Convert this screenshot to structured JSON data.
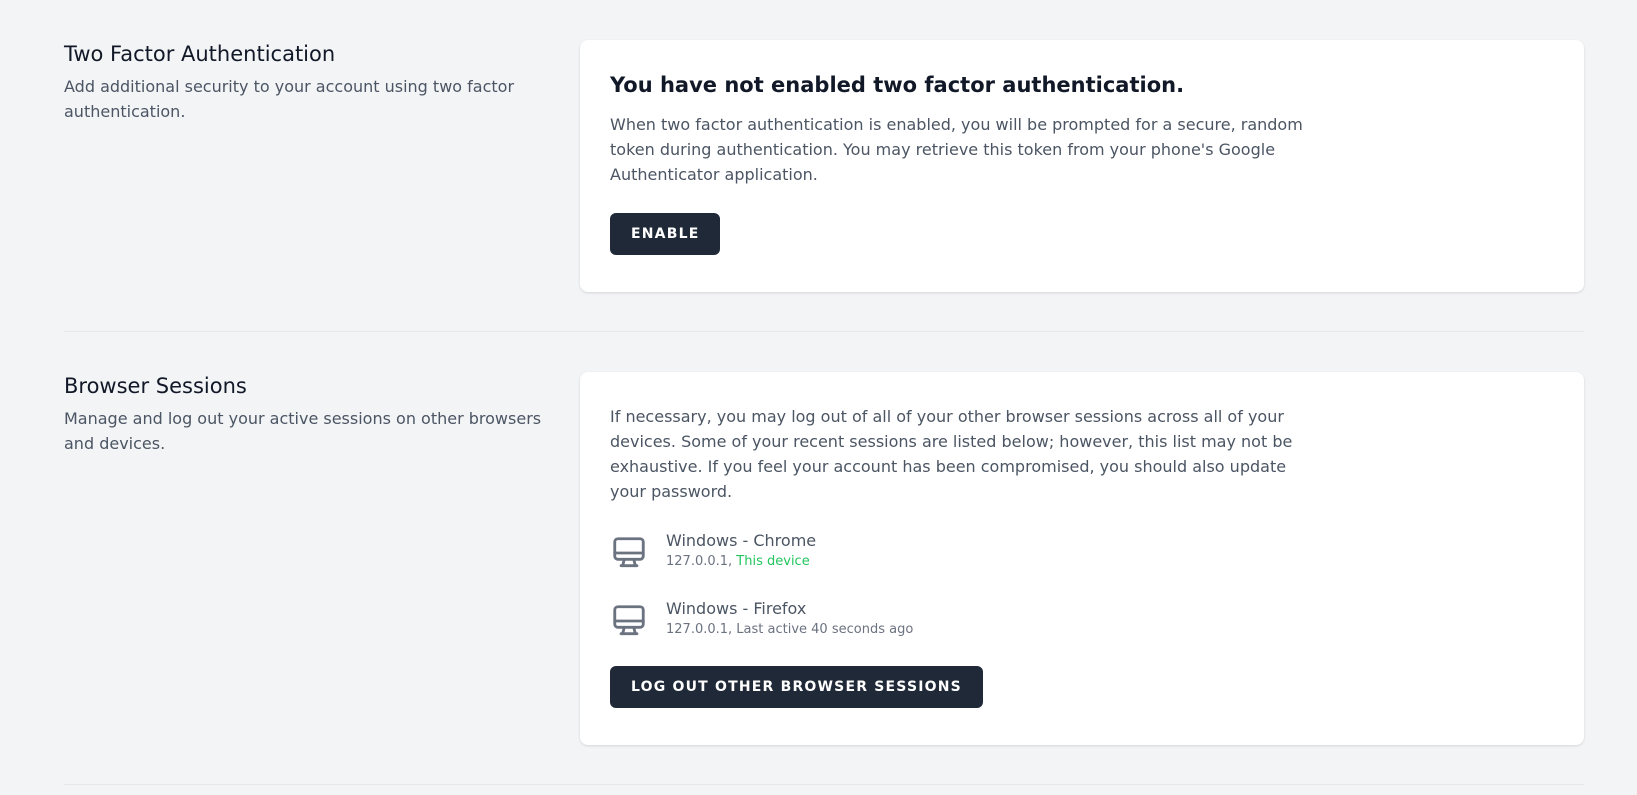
{
  "two_factor": {
    "title": "Two Factor Authentication",
    "description": "Add additional security to your account using two factor authentication.",
    "heading": "You have not enabled two factor authentication.",
    "body": "When two factor authentication is enabled, you will be prompted for a secure, random token during authentication. You may retrieve this token from your phone's Google Authenticator application.",
    "enable_label": "Enable"
  },
  "browser_sessions": {
    "title": "Browser Sessions",
    "description": "Manage and log out your active sessions on other browsers and devices.",
    "body": "If necessary, you may log out of all of your other browser sessions across all of your devices. Some of your recent sessions are listed below; however, this list may not be exhaustive. If you feel your account has been compromised, you should also update your password.",
    "sessions": [
      {
        "name": "Windows - Chrome",
        "ip": "127.0.0.1,",
        "status": "This device",
        "icon": "desktop-icon"
      },
      {
        "name": "Windows - Firefox",
        "ip": "127.0.0.1,",
        "status": "Last active 40 seconds ago",
        "icon": "desktop-icon"
      }
    ],
    "logout_label": "Log Out Other Browser Sessions"
  },
  "colors": {
    "page_bg": "#f3f4f6",
    "card_bg": "#ffffff",
    "button_bg": "#1f2937",
    "active_green": "#22c55e",
    "muted_text": "#4b5563"
  }
}
